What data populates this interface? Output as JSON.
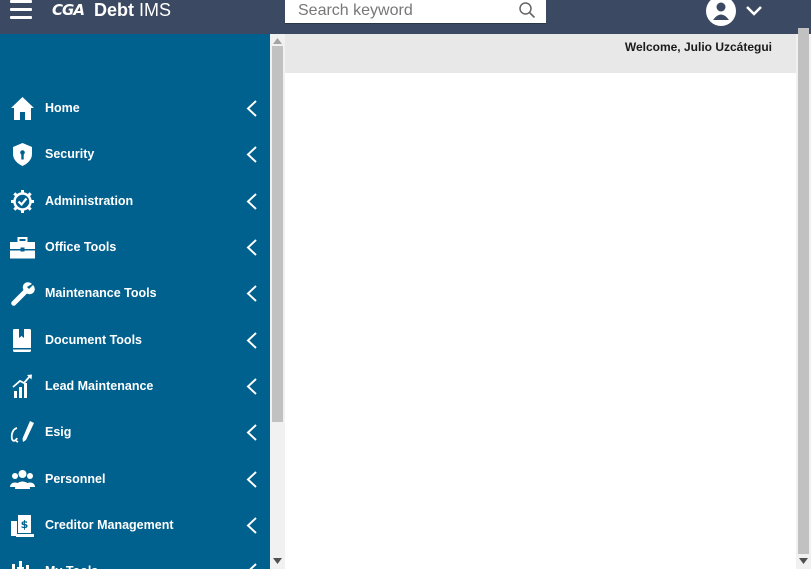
{
  "header": {
    "logo_mark": "CGA",
    "brand_bold": "Debt",
    "brand_rest": " IMS",
    "search": {
      "placeholder": "Search keyword"
    }
  },
  "welcome": "Welcome, Julio Uzcátegui",
  "sidebar": {
    "items": [
      {
        "label": "Home",
        "icon": "home-icon"
      },
      {
        "label": "Security",
        "icon": "shield-icon"
      },
      {
        "label": "Administration",
        "icon": "gear-check-icon"
      },
      {
        "label": "Office Tools",
        "icon": "briefcase-icon"
      },
      {
        "label": "Maintenance Tools",
        "icon": "wrench-icon"
      },
      {
        "label": "Document Tools",
        "icon": "book-icon"
      },
      {
        "label": "Lead Maintenance",
        "icon": "chart-icon"
      },
      {
        "label": "Esig",
        "icon": "signature-icon"
      },
      {
        "label": "Personnel",
        "icon": "people-icon"
      },
      {
        "label": "Creditor Management",
        "icon": "money-doc-icon"
      },
      {
        "label": "My Tools",
        "icon": "tools-icon"
      }
    ]
  },
  "colors": {
    "topbar": "#3b4a62",
    "sidebar": "#00608e",
    "welcome_bar": "#e8e8e8"
  }
}
